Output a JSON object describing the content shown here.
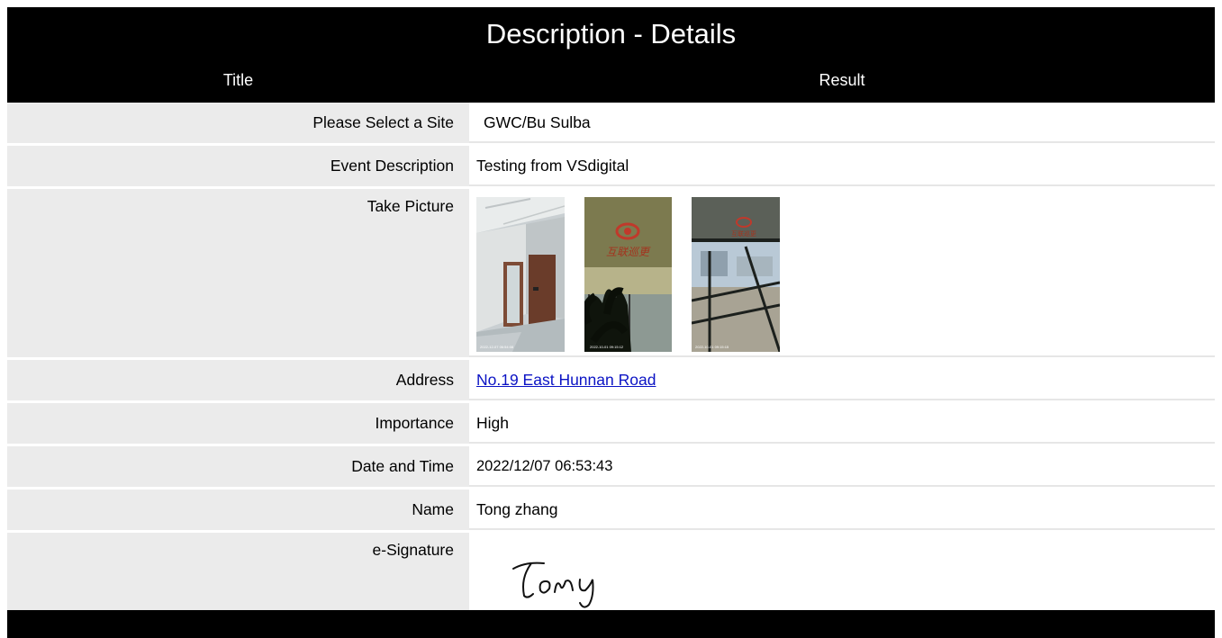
{
  "page": {
    "title": "Description - Details"
  },
  "columns": {
    "title": "Title",
    "result": "Result"
  },
  "rows": {
    "site": {
      "label": "Please Select a Site",
      "value": "GWC/Bu Sulba"
    },
    "event": {
      "label": "Event Description",
      "value": "Testing from VSdigital"
    },
    "picture": {
      "label": "Take Picture",
      "photos": [
        {
          "stamp": "2022-12-07 06:54:08"
        },
        {
          "stamp": "2022-10-01 09:15:12",
          "sign": "互联巡更"
        },
        {
          "stamp": "2022-10-01 09:15:15",
          "sign": "互联巡更"
        }
      ]
    },
    "address": {
      "label": "Address",
      "value": "No.19 East Hunnan Road"
    },
    "importance": {
      "label": "Importance",
      "value": "High"
    },
    "datetime": {
      "label": "Date and Time",
      "value": "2022/12/07 06:53:43"
    },
    "name": {
      "label": "Name",
      "value": "Tong zhang"
    },
    "signature": {
      "label": "e-Signature",
      "handwriting": "Tony"
    }
  },
  "colors": {
    "header": "#000000",
    "label_bg": "#ebebeb",
    "link": "#0b13c4",
    "logo_red": "#c0392b"
  }
}
